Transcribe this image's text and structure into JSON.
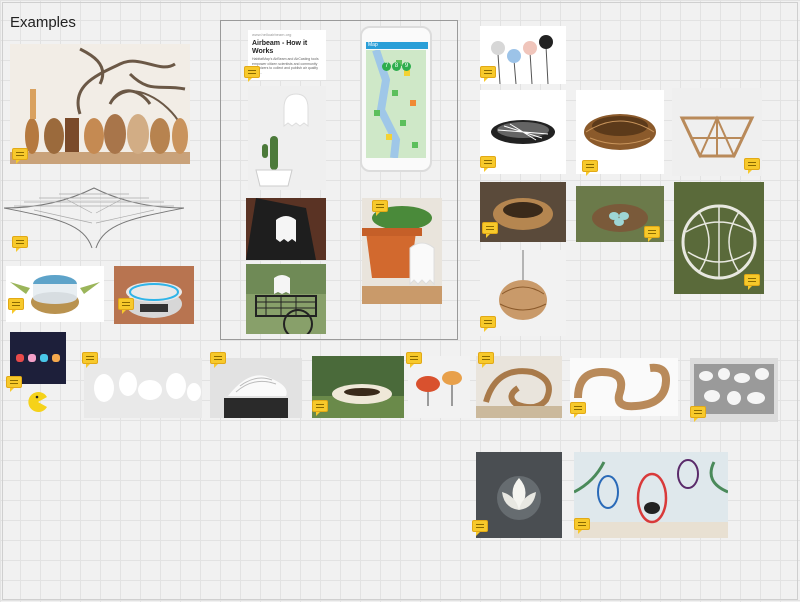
{
  "board": {
    "title": "Examples"
  },
  "card": {
    "source": "www.helloairbeam.org",
    "heading": "Airbeam - How it Works",
    "body": "HabitatMap's AirBeam and AirCasting tools empower citizen scientists and community organizers to collect and publish air quality data..."
  },
  "phone": {
    "app_label": "Map",
    "readings": [
      "7",
      "8",
      "9"
    ]
  }
}
